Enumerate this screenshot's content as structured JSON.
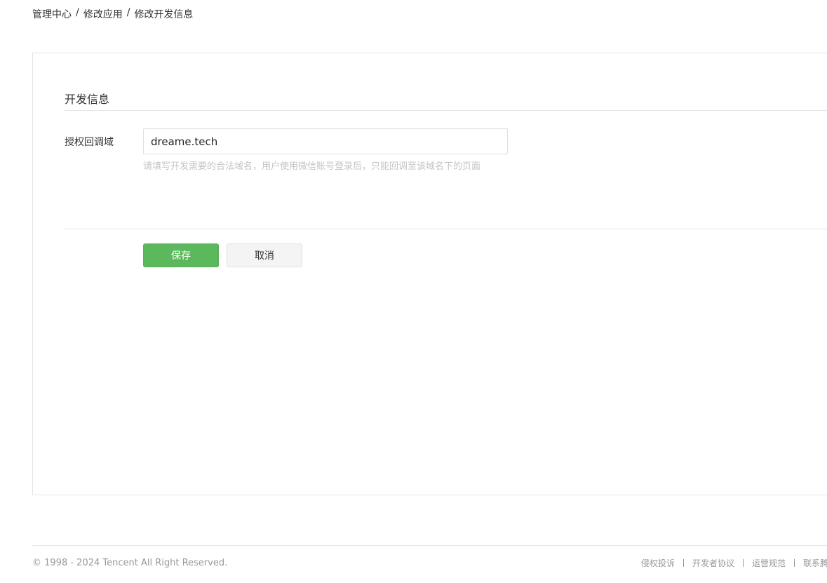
{
  "breadcrumb": {
    "items": [
      "管理中心",
      "修改应用",
      "修改开发信息"
    ],
    "separator": "/"
  },
  "section": {
    "title": "开发信息"
  },
  "form": {
    "callback_domain": {
      "label": "授权回调域",
      "value": "dreame.tech",
      "hint": "请填写开发需要的合法域名，用户使用微信账号登录后，只能回调至该域名下的页面"
    },
    "save_label": "保存",
    "cancel_label": "取消"
  },
  "footer": {
    "copyright": "© 1998 - 2024 Tencent All Right Reserved.",
    "links": [
      "侵权投诉",
      "开发者协议",
      "运营规范",
      "联系腾讯"
    ]
  },
  "colors": {
    "primary_button": "#5cb85c",
    "hint_text": "#c4c4c4"
  }
}
